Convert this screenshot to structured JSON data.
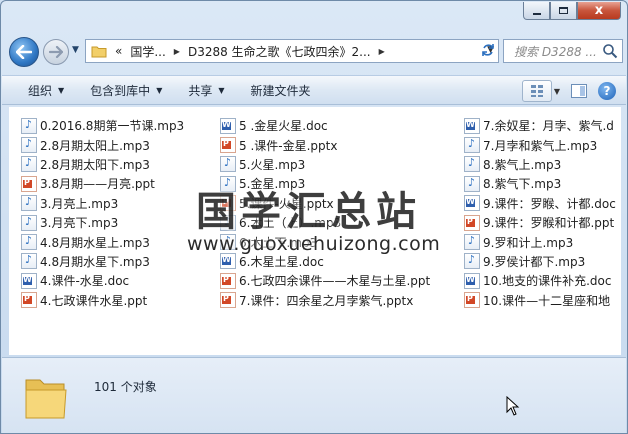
{
  "window": {
    "caption_close": "x"
  },
  "address": {
    "crumbs": [
      "«",
      "国学...",
      "D3288 生命之歌《七政四余》2..."
    ]
  },
  "search": {
    "placeholder": "搜索 D3288 ..."
  },
  "commands": [
    {
      "label": "组织",
      "has_dropdown": true
    },
    {
      "label": "包含到库中",
      "has_dropdown": true
    },
    {
      "label": "共享",
      "has_dropdown": true
    },
    {
      "label": "新建文件夹",
      "has_dropdown": false
    }
  ],
  "files": {
    "col1": [
      {
        "name": "0.2016.8期第一节课.mp3",
        "type": "mp3"
      },
      {
        "name": "2.8月期太阳上.mp3",
        "type": "mp3"
      },
      {
        "name": "2.8月期太阳下.mp3",
        "type": "mp3"
      },
      {
        "name": "3.8月期——月亮.ppt",
        "type": "ppt"
      },
      {
        "name": "3.月亮上.mp3",
        "type": "mp3"
      },
      {
        "name": "3.月亮下.mp3",
        "type": "mp3"
      },
      {
        "name": "4.8月期水星上.mp3",
        "type": "mp3"
      },
      {
        "name": "4.8月期水星下.mp3",
        "type": "mp3"
      },
      {
        "name": "4.课件-水星.doc",
        "type": "doc"
      },
      {
        "name": "4.七政课件水星.ppt",
        "type": "ppt"
      }
    ],
    "col2": [
      {
        "name": "5 .金星火星.doc",
        "type": "doc"
      },
      {
        "name": "5 .课件-金星.pptx",
        "type": "ppt"
      },
      {
        "name": "5.火星.mp3",
        "type": "mp3"
      },
      {
        "name": "5.金星.mp3",
        "type": "mp3"
      },
      {
        "name": "5.课件-火星.pptx",
        "type": "ppt"
      },
      {
        "name": "6.木土（上）.mp3",
        "type": "mp3"
      },
      {
        "name": "6.木土下.mp3",
        "type": "mp3"
      },
      {
        "name": "6.木星土星.doc",
        "type": "doc"
      },
      {
        "name": "6.七政四余课件——木星与土星.ppt",
        "type": "ppt"
      },
      {
        "name": "7.课件：四余星之月孛紫气.pptx",
        "type": "ppt"
      }
    ],
    "col3": [
      {
        "name": "7.余奴星：月孛、紫气.d",
        "type": "doc"
      },
      {
        "name": "7.月孛和紫气上.mp3",
        "type": "mp3"
      },
      {
        "name": "8.紫气上.mp3",
        "type": "mp3"
      },
      {
        "name": "8.紫气下.mp3",
        "type": "mp3"
      },
      {
        "name": "9.课件：罗睺、计都.doc",
        "type": "doc"
      },
      {
        "name": "9.课件：罗睺和计都.ppt",
        "type": "ppt"
      },
      {
        "name": "9.罗和计上.mp3",
        "type": "mp3"
      },
      {
        "name": "9.罗侯计都下.mp3",
        "type": "mp3"
      },
      {
        "name": "10.地支的课件补充.doc",
        "type": "doc"
      },
      {
        "name": "10.课件—十二星座和地",
        "type": "ppt"
      }
    ]
  },
  "watermark": {
    "title": "国学汇总站",
    "url": "www.guoxuehuizong.com"
  },
  "status": {
    "count_text": "101 个对象"
  }
}
